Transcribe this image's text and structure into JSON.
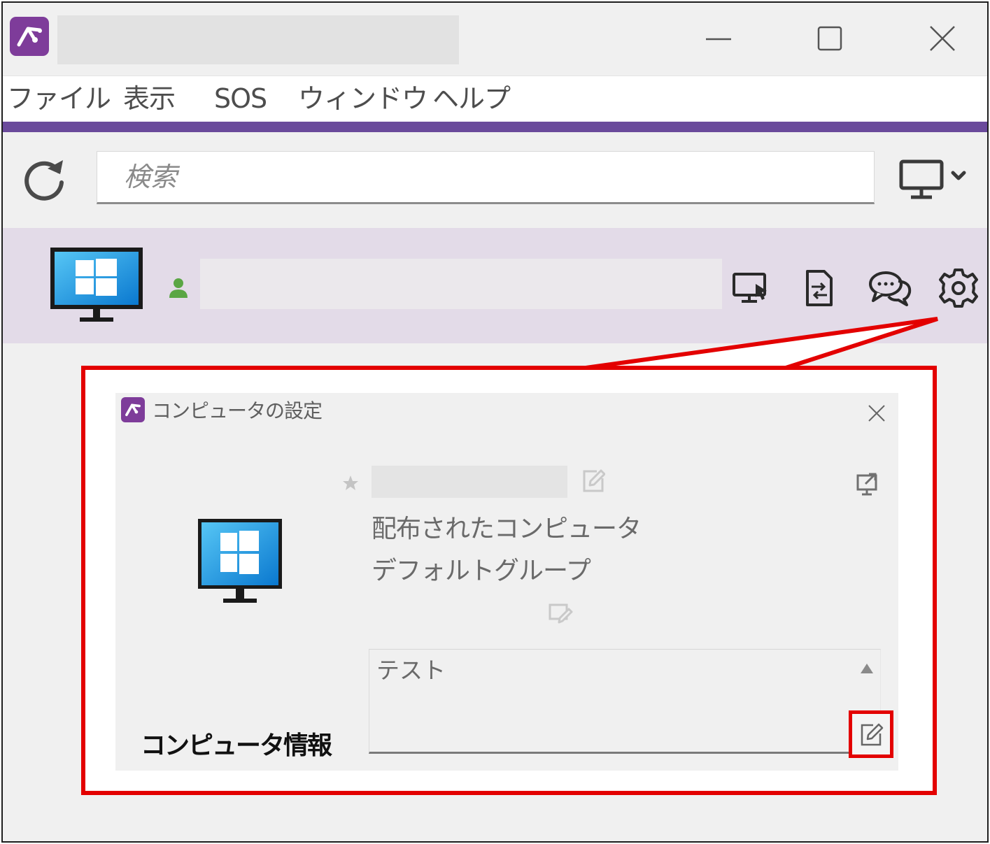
{
  "window": {
    "app_icon": "splashtop-icon",
    "controls": [
      "minimize-icon",
      "maximize-icon",
      "close-icon"
    ]
  },
  "menu": {
    "items": [
      "ファイル",
      "表示",
      "SOS",
      "ウィンドウ",
      "ヘルプ"
    ]
  },
  "toolbar": {
    "refresh_icon": "refresh-icon",
    "search_placeholder": "検索",
    "view_icon": "monitor-dropdown-icon"
  },
  "computer": {
    "os_icon": "windows-monitor-icon",
    "status_icon": "user-online-icon",
    "actions": [
      "remote-connect-icon",
      "file-transfer-icon",
      "chat-icon",
      "settings-gear-icon"
    ]
  },
  "dialog": {
    "title": "コンピュータの設定",
    "role": "配布されたコンピュータ",
    "group": "デフォルトグループ",
    "notes": "テスト",
    "section_title": "コンピュータ情報"
  },
  "colors": {
    "accent": "#6a4a9b",
    "brand": "#7e3c9a",
    "row_highlight": "#e3dbe8",
    "callout": "#e30000",
    "online": "#5aa644"
  }
}
